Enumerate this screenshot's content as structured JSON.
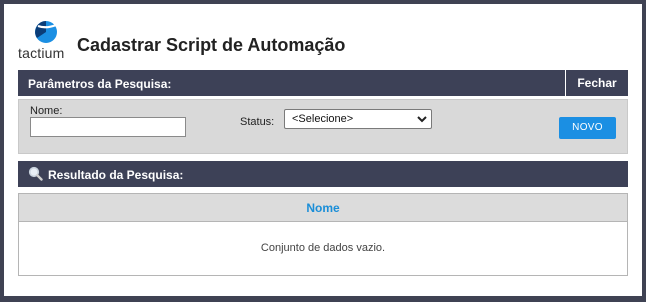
{
  "logo": {
    "text": "tactium",
    "brand_color": "#1b8fe3"
  },
  "page_title": "Cadastrar Script de Automação",
  "params_bar": {
    "title": "Parâmetros da Pesquisa:",
    "close_label": "Fechar"
  },
  "search": {
    "nome_label": "Nome:",
    "nome_value": "",
    "status_label": "Status:",
    "status_selected": "<Selecione>",
    "new_button_label": "NOVO"
  },
  "results_bar": {
    "title": "Resultado da Pesquisa:"
  },
  "results": {
    "column_header": "Nome",
    "empty_message": "Conjunto de dados vazio."
  },
  "colors": {
    "bar_bg": "#3d4157",
    "accent": "#1b8fe3",
    "panel_bg": "#d9d9d9"
  }
}
